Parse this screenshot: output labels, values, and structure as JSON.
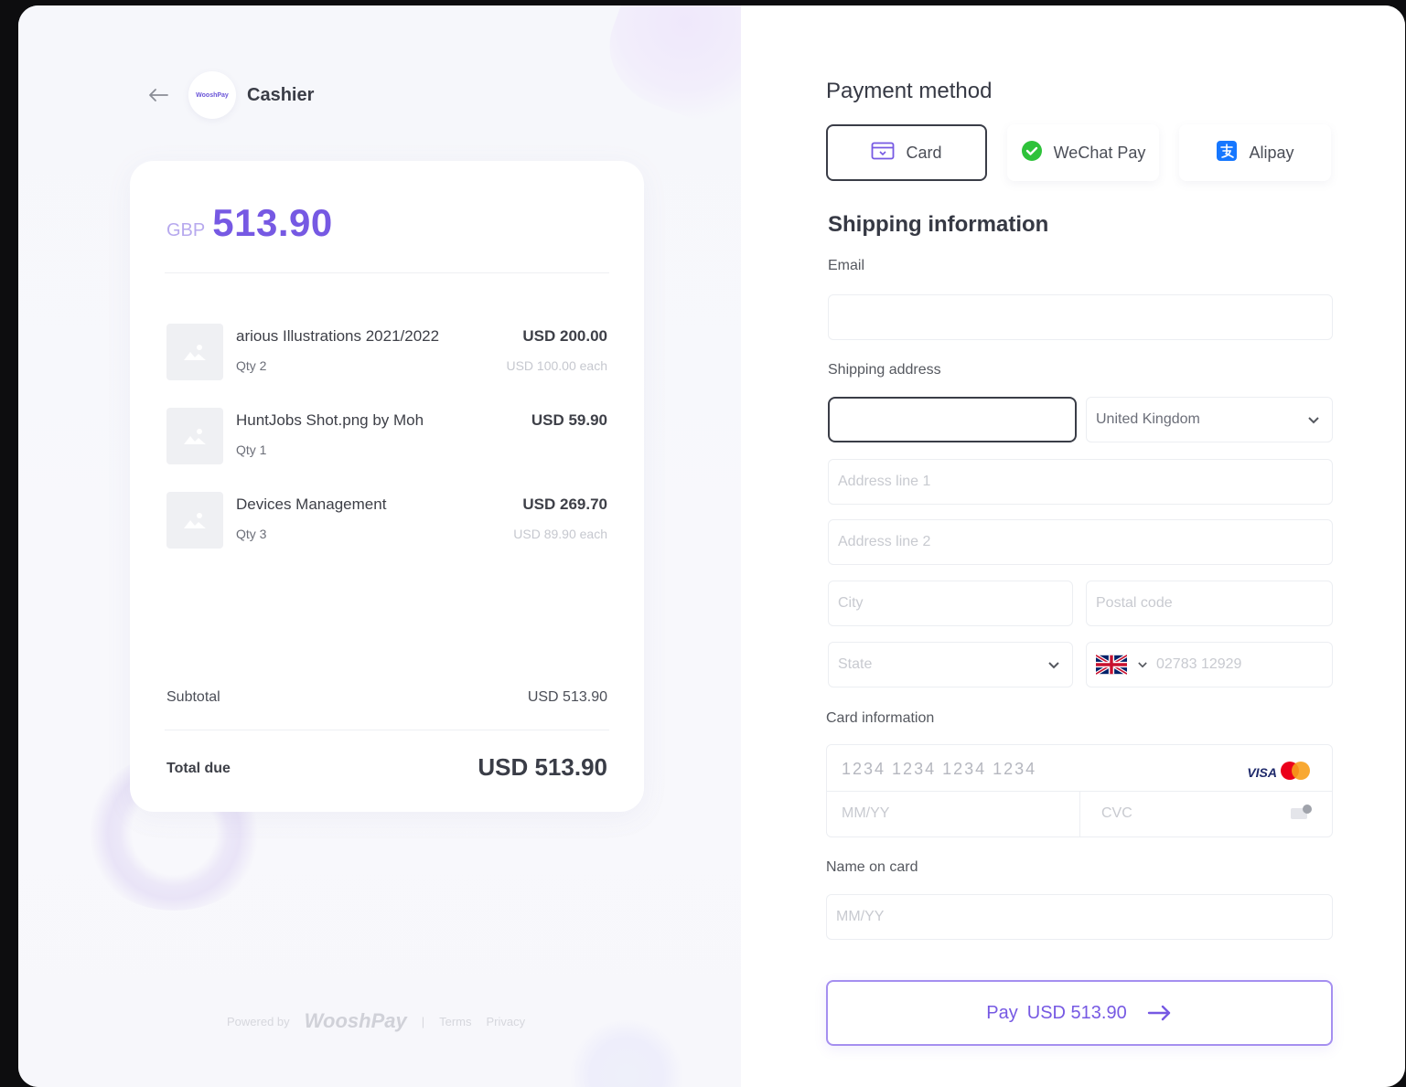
{
  "app": {
    "title": "Cashier",
    "logo_text": "WooshPay"
  },
  "summary": {
    "currency": "GBP",
    "amount": "513.90",
    "items": [
      {
        "name": "arious Illustrations 2021/2022",
        "qty": "Qty 2",
        "price": "USD 200.00",
        "each": "USD 100.00 each"
      },
      {
        "name": "HuntJobs Shot.png by Moh",
        "qty": "Qty 1",
        "price": "USD 59.90",
        "each": ""
      },
      {
        "name": "Devices Management",
        "qty": "Qty 3",
        "price": "USD 269.70",
        "each": "USD 89.90 each"
      }
    ],
    "subtotal_label": "Subtotal",
    "subtotal_value": "USD 513.90",
    "total_label": "Total due",
    "total_value": "USD 513.90"
  },
  "footer": {
    "powered_by": "Powered by",
    "brand": "WooshPay",
    "terms": "Terms",
    "privacy": "Privacy"
  },
  "payment": {
    "heading": "Payment method",
    "tabs": [
      {
        "label": "Card",
        "icon": "card-icon",
        "active": true
      },
      {
        "label": "WeChat Pay",
        "icon": "wechat-icon",
        "active": false
      },
      {
        "label": "Alipay",
        "icon": "alipay-icon",
        "active": false
      }
    ]
  },
  "shipping": {
    "heading": "Shipping information",
    "email_label": "Email",
    "email_value": "",
    "address_label": "Shipping address",
    "name_value": "",
    "country": "United Kingdom",
    "address1_placeholder": "Address line 1",
    "address2_placeholder": "Address line 2",
    "city_placeholder": "City",
    "postal_placeholder": "Postal code",
    "state_placeholder": "State",
    "phone_placeholder": "02783 12929"
  },
  "card": {
    "label": "Card information",
    "number_placeholder": "1234 1234 1234 1234",
    "expiry_placeholder": "MM/YY",
    "cvc_placeholder": "CVC",
    "visa": "VISA",
    "name_label": "Name on card",
    "name_placeholder": "MM/YY"
  },
  "pay_button": {
    "label": "Pay",
    "amount": "USD 513.90"
  },
  "colors": {
    "accent": "#7659e3",
    "accent_light": "#b7a9ee",
    "border_dark": "#3a3d47",
    "wechat": "#2ec23a",
    "alipay": "#1677ff",
    "mc_red": "#eb001b",
    "mc_orange": "#f79e1b"
  }
}
